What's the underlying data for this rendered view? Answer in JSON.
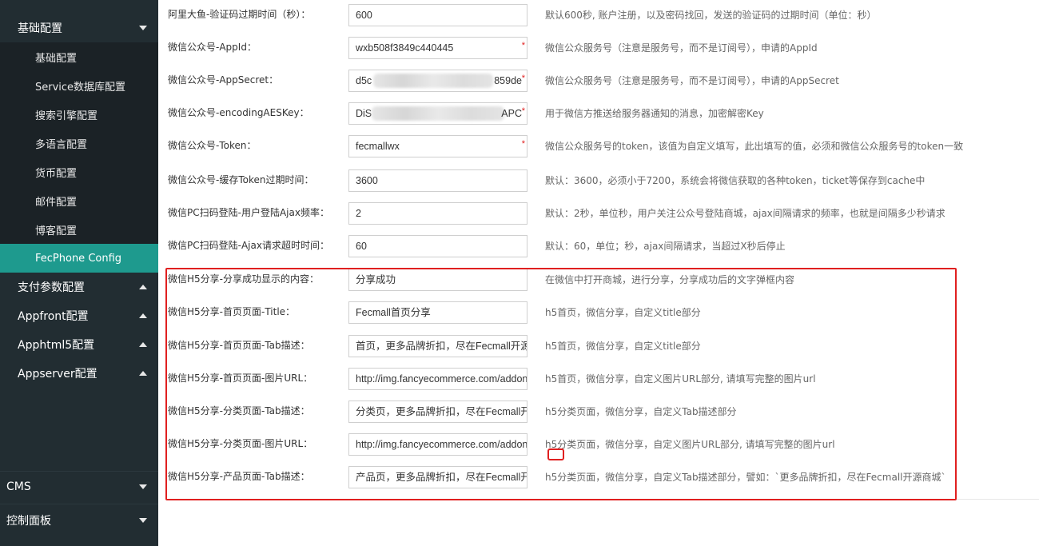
{
  "sidebar": {
    "groups": [
      {
        "label": "基础配置"
      },
      {
        "label": "支付参数配置"
      },
      {
        "label": "Appfront配置"
      },
      {
        "label": "Apphtml5配置"
      },
      {
        "label": "Appserver配置"
      }
    ],
    "sub_items": [
      {
        "label": "基础配置"
      },
      {
        "label": "Service数据库配置"
      },
      {
        "label": "搜索引擎配置"
      },
      {
        "label": "多语言配置"
      },
      {
        "label": "货币配置"
      },
      {
        "label": "邮件配置"
      },
      {
        "label": "博客配置"
      },
      {
        "label": "FecPhone Config",
        "active": true
      }
    ],
    "bottom_items": [
      {
        "label": "CMS"
      },
      {
        "label": "控制面板"
      }
    ],
    "colors": {
      "background": "#222d32",
      "active": "#1e9a8e"
    }
  },
  "form": {
    "rows": [
      {
        "label": "阿里大鱼-验证码过期时间（秒）：",
        "value": "600",
        "required": false,
        "help": "默认600秒, 账户注册，以及密码找回，发送的验证码的过期时间（单位：秒）"
      },
      {
        "label": "微信公众号-AppId：",
        "value": "wxb508f3849c440445",
        "required": true,
        "help": "微信公众服务号（注意是服务号，而不是订阅号），申请的AppId"
      },
      {
        "label": "微信公众号-AppSecret：",
        "value": "d5c",
        "value_tail": "859de",
        "masked": true,
        "required": true,
        "help": "微信公众服务号（注意是服务号，而不是订阅号），申请的AppSecret"
      },
      {
        "label": "微信公众号-encodingAESKey：",
        "value": "DiS",
        "value_tail": "APC",
        "masked": true,
        "required": true,
        "help": "用于微信方推送给服务器通知的消息，加密解密Key"
      },
      {
        "label": "微信公众号-Token：",
        "value": "fecmallwx",
        "required": true,
        "help": "微信公众服务号的token，该值为自定义填写，此出填写的值，必须和微信公众服务号的token一致"
      },
      {
        "label": "微信公众号-缓存Token过期时间：",
        "value": "3600",
        "required": false,
        "help": "默认：3600，必须小于7200，系统会将微信获取的各种token，ticket等保存到cache中"
      },
      {
        "label": "微信PC扫码登陆-用户登陆Ajax频率：",
        "value": "2",
        "required": false,
        "help": "默认：2秒，单位秒，用户关注公众号登陆商城，ajax间隔请求的频率，也就是间隔多少秒请求"
      },
      {
        "label": "微信PC扫码登陆-Ajax请求超时时间：",
        "value": "60",
        "required": false,
        "help": "默认：60，单位；秒，ajax间隔请求，当超过X秒后停止"
      },
      {
        "label": "微信H5分享-分享成功显示的内容：",
        "value": "分享成功",
        "required": false,
        "help": "在微信中打开商城，进行分享，分享成功后的文字弹框内容"
      },
      {
        "label": "微信H5分享-首页页面-Title：",
        "value": "Fecmall首页分享",
        "required": false,
        "help": "h5首页，微信分享，自定义title部分"
      },
      {
        "label": "微信H5分享-首页页面-Tab描述：",
        "value": "首页，更多品牌折扣，尽在Fecmall开源",
        "required": false,
        "help": "h5首页，微信分享，自定义title部分"
      },
      {
        "label": "微信H5分享-首页页面-图片URL：",
        "value": "http://img.fancyecommerce.com/addon",
        "required": false,
        "help": "h5首页，微信分享，自定义图片URL部分, 请填写完整的图片url"
      },
      {
        "label": "微信H5分享-分类页面-Tab描述：",
        "value": "分类页，更多品牌折扣，尽在Fecmall开",
        "required": false,
        "help": "h5分类页面，微信分享，自定义Tab描述部分"
      },
      {
        "label": "微信H5分享-分类页面-图片URL：",
        "value": "http://img.fancyecommerce.com/addon",
        "required": false,
        "help": "h5分类页面，微信分享，自定义图片URL部分, 请填写完整的图片url"
      },
      {
        "label": "微信H5分享-产品页面-Tab描述：",
        "value": "产品页，更多品牌折扣，尽在Fecmall开",
        "required": false,
        "help": "h5分类页面，微信分享，自定义Tab描述部分，譬如：`更多品牌折扣，尽在Fecmall开源商城`"
      }
    ],
    "required_mark": "*"
  }
}
